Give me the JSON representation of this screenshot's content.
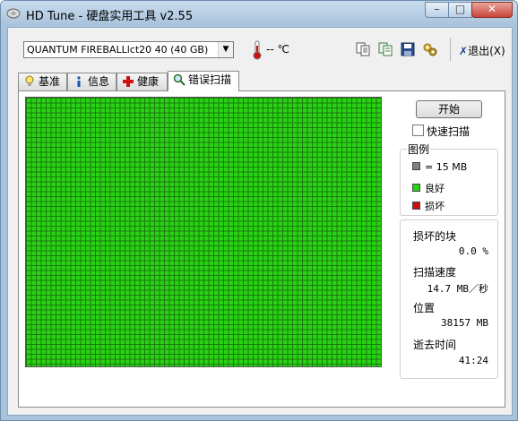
{
  "window": {
    "title": "HD Tune - 硬盘实用工具 v2.55",
    "min": "–",
    "max": "□",
    "close": "✕"
  },
  "toolbar": {
    "drive": "QUANTUM FIREBALLlct20 40 (40 GB)",
    "temperature": "-- ℃",
    "exit_label": "退出(X)"
  },
  "tabs": [
    {
      "label": "基准"
    },
    {
      "label": "信息"
    },
    {
      "label": "健康"
    },
    {
      "label": "错误扫描"
    }
  ],
  "scan": {
    "start_label": "开始",
    "quick_scan_label": "快速扫描",
    "quick_scan_checked": false,
    "legend": {
      "title": "图例",
      "block_size": "= 15 MB",
      "good": "良好",
      "damaged": "损坏"
    },
    "stats": {
      "damaged_blocks_label": "损坏的块",
      "damaged_blocks_value": "0.0 %",
      "speed_label": "扫描速度",
      "speed_value": "14.7 MB／秒",
      "position_label": "位置",
      "position_value": "38157 MB",
      "elapsed_label": "逝去时间",
      "elapsed_value": "41:24"
    }
  },
  "colors": {
    "good_block": "#27d312",
    "damaged_block": "#cc1010",
    "unscanned_block": "#808080",
    "window_frame": "#a9c3dc"
  }
}
